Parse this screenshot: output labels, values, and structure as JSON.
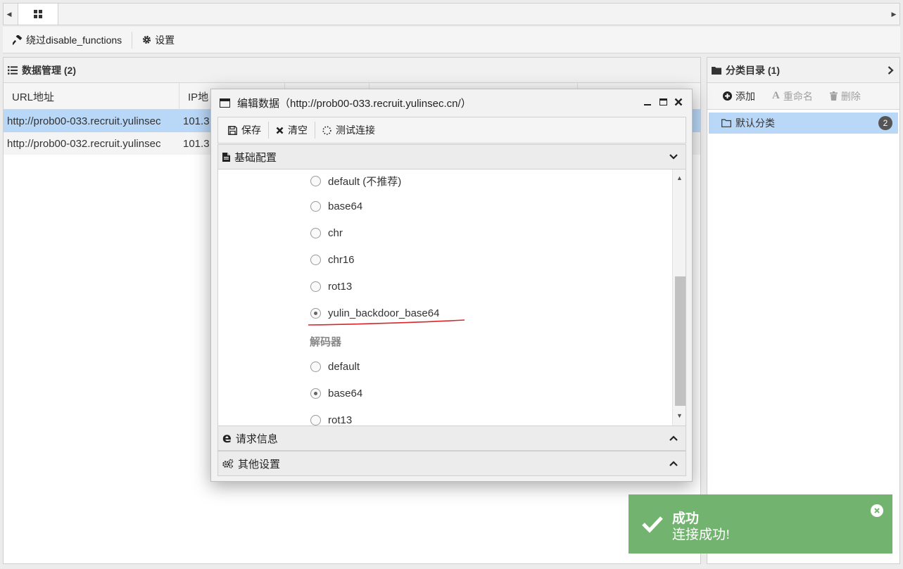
{
  "toolbar": {
    "bypass_label": "绕过disable_functions",
    "settings_label": "设置"
  },
  "data_panel": {
    "title": "数据管理 (2)",
    "columns": [
      "URL地址",
      "IP地"
    ],
    "rows": [
      {
        "url": "http://prob00-033.recruit.yulinsec",
        "ip": "101.3"
      },
      {
        "url": "http://prob00-032.recruit.yulinsec",
        "ip": "101.3"
      }
    ]
  },
  "category_panel": {
    "title": "分类目录 (1)",
    "add_label": "添加",
    "rename_label": "重命名",
    "delete_label": "删除",
    "items": [
      {
        "label": "默认分类",
        "count": "2"
      }
    ]
  },
  "modal": {
    "title": "编辑数据（http://prob00-033.recruit.yulinsec.cn/）",
    "save_label": "保存",
    "clear_label": "清空",
    "test_label": "测试连接",
    "section_basic": "基础配置",
    "section_request": "请求信息",
    "section_other": "其他设置",
    "encoders": [
      "default (不推荐)",
      "base64",
      "chr",
      "chr16",
      "rot13",
      "yulin_backdoor_base64"
    ],
    "encoder_selected": "yulin_backdoor_base64",
    "decoder_label": "解码器",
    "decoders": [
      "default",
      "base64",
      "rot13"
    ],
    "decoder_selected": "base64"
  },
  "toast": {
    "title": "成功",
    "message": "连接成功!"
  },
  "colors": {
    "selection": "#b9d7f7",
    "toast_bg": "#72b46f",
    "annotation": "#d9262b"
  }
}
